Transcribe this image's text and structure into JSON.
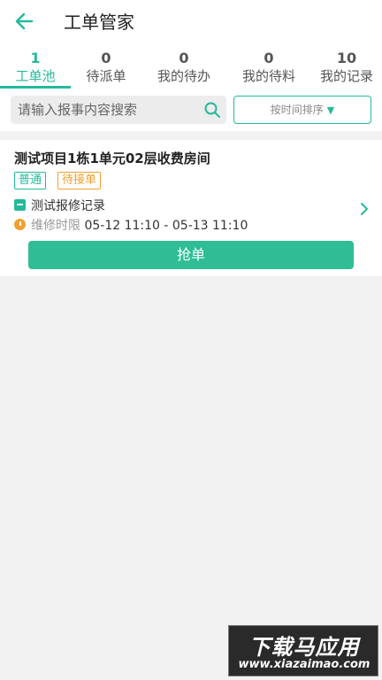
{
  "header": {
    "title": "工单管家"
  },
  "tabs": [
    {
      "count": "1",
      "label": "工单池",
      "active": true
    },
    {
      "count": "0",
      "label": "待派单"
    },
    {
      "count": "0",
      "label": "我的待办"
    },
    {
      "count": "0",
      "label": "我的待料"
    },
    {
      "count": "10",
      "label": "我的记录"
    }
  ],
  "search": {
    "placeholder": "请输入报事内容搜索",
    "sort_label": "按时间排序",
    "sort_arrow": "▼"
  },
  "orders": [
    {
      "title": "测试项目1栋1单元02层收费房间",
      "tags": [
        "普通",
        "待接单"
      ],
      "record": "测试报修记录",
      "deadline_label": "维修时限",
      "deadline": "05-12 11:10 - 05-13 11:10",
      "action_label": "抢单"
    }
  ],
  "watermark": {
    "line1": "下载马应用",
    "line2": "www.xiazaimao.com"
  },
  "colors": {
    "accent": "#25b99a",
    "warning": "#f0a030",
    "button": "#2ebd94"
  }
}
